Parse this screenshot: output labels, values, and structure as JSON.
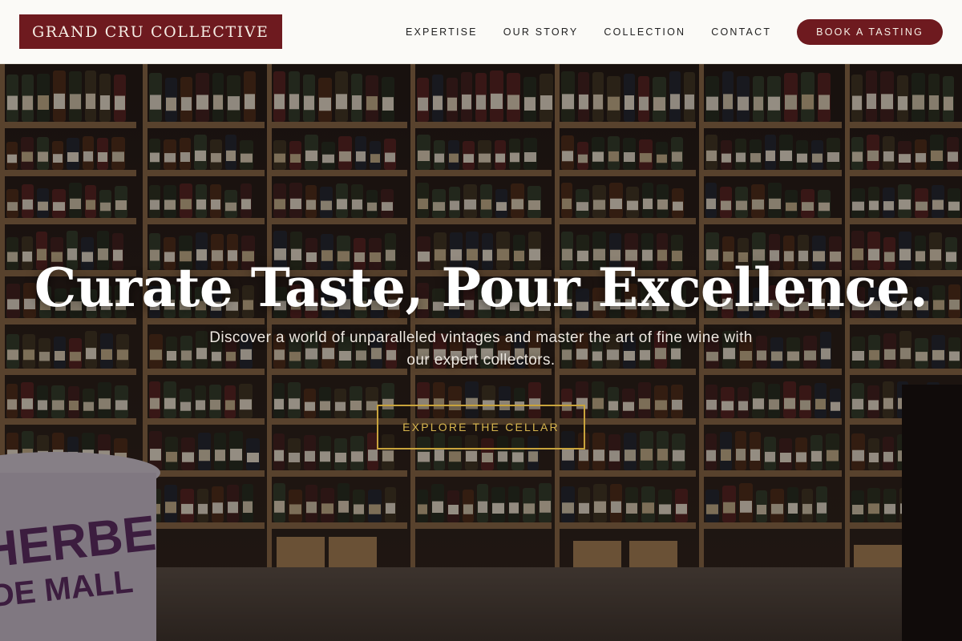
{
  "brand": {
    "name": "GRAND CRU COLLECTIVE"
  },
  "nav": {
    "links": [
      "EXPERTISE",
      "OUR STORY",
      "COLLECTION",
      "CONTACT"
    ],
    "cta_label": "BOOK A TASTING"
  },
  "hero": {
    "title": "Curate Taste, Pour Excellence.",
    "subtitle": "Discover a world of unparalleled vintages and master the art of fine wine with our expert collectors.",
    "button_label": "EXPLORE THE CELLAR",
    "image": "wine-shop-shelves-photo"
  },
  "colors": {
    "brand": "#6e1a1f",
    "accent": "#c9a43c",
    "header_bg": "#fbfaf7"
  }
}
